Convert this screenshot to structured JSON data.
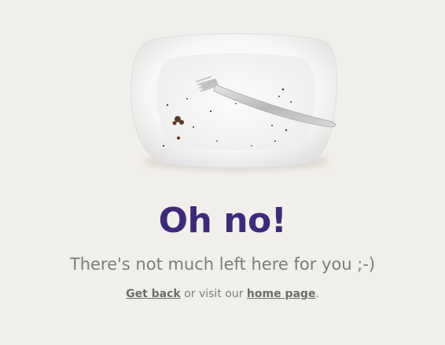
{
  "main": {
    "illustration_name": "empty-plate-with-fork",
    "title": "Oh no!",
    "subtitle": "There's not much left here for you ;-)",
    "links": {
      "get_back_label": "Get back",
      "middle_text": " or visit our ",
      "home_page_label": "home page",
      "end_text": "."
    }
  },
  "colors": {
    "background": "#f1efeb",
    "title": "#3e2a78",
    "text": "#7c7c7c"
  }
}
